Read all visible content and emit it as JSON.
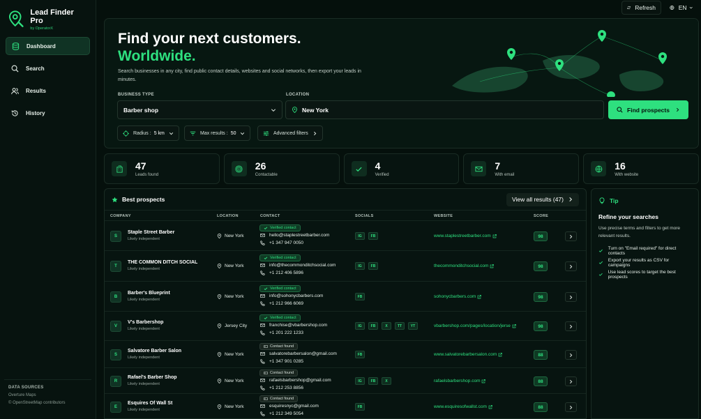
{
  "brand": {
    "title": "Lead Finder Pro",
    "subtitle": "by OperatorX"
  },
  "nav": [
    {
      "label": "Dashboard"
    },
    {
      "label": "Search"
    },
    {
      "label": "Results"
    },
    {
      "label": "History"
    }
  ],
  "sources": {
    "heading": "DATA SOURCES",
    "items": [
      "Overture Maps",
      "© OpenStreetMap contributors"
    ]
  },
  "topbar": {
    "refresh": "Refresh",
    "lang": "EN"
  },
  "hero": {
    "title_line1": "Find your next customers.",
    "title_line2": "Worldwide.",
    "description": "Search businesses in any city, find public contact details, websites and social networks, then export your leads in minutes.",
    "business_type_label": "BUSINESS TYPE",
    "business_type_value": "Barber shop",
    "location_label": "LOCATION",
    "location_value": "New York",
    "find_button": "Find prospects",
    "radius_label": "Radius :",
    "radius_value": "5 km",
    "max_label": "Max results :",
    "max_value": "50",
    "advanced": "Advanced filters"
  },
  "stats": [
    {
      "num": "47",
      "cap": "Leads found"
    },
    {
      "num": "26",
      "cap": "Contactable"
    },
    {
      "num": "4",
      "cap": "Verified"
    },
    {
      "num": "7",
      "cap": "With email"
    },
    {
      "num": "16",
      "cap": "With website"
    }
  ],
  "prospects": {
    "title": "Best prospects",
    "view_all": "View all results (47)",
    "columns": [
      "COMPANY",
      "LOCATION",
      "CONTACT",
      "SOCIALS",
      "WEBSITE",
      "SCORE"
    ],
    "rows": [
      {
        "initial": "S",
        "name": "Staple Street Barber",
        "sub": "Likely independent",
        "location": "New York",
        "badge": "Verified contact",
        "email": "hello@staplestreetbarber.com",
        "phone": "+1 347 947 0050",
        "socials": [
          "IG",
          "FB"
        ],
        "website": "www.staplestreetbarber.com",
        "score": "98"
      },
      {
        "initial": "T",
        "name": "THE COMMON DITCH SOCIAL",
        "sub": "Likely independent",
        "location": "New York",
        "badge": "Verified contact",
        "email": "info@thecommonditchsocial.com",
        "phone": "+1 212 406 5896",
        "socials": [
          "IG",
          "FB"
        ],
        "website": "thecommonditchsocial.com",
        "score": "98"
      },
      {
        "initial": "B",
        "name": "Barber's Blueprint",
        "sub": "Likely independent",
        "location": "New York",
        "badge": "Verified contact",
        "email": "info@sohonycbarbers.com",
        "phone": "+1 212 966 6069",
        "socials": [
          "FB"
        ],
        "website": "sohonycbarbers.com",
        "score": "98"
      },
      {
        "initial": "V",
        "name": "V's Barbershop",
        "sub": "Likely independent",
        "location": "Jersey City",
        "badge": "Verified contact",
        "email": "franchise@vbarbershop.com",
        "phone": "+1 201 222 1233",
        "socials": [
          "IG",
          "FB",
          "X",
          "TT",
          "YT"
        ],
        "website": "vbarbershop.com/pages/location/jerse",
        "score": "98"
      },
      {
        "initial": "S",
        "name": "Salvatore Barber Salon",
        "sub": "Likely independent",
        "location": "New York",
        "badge": "Contact found",
        "email": "salvatorebarbersalon@gmail.com",
        "phone": "+1 347 901 0285",
        "socials": [
          "FB"
        ],
        "website": "www.salvatorebarbersalon.com",
        "score": "88"
      },
      {
        "initial": "R",
        "name": "Rafael's Barber Shop",
        "sub": "Likely independent",
        "location": "New York",
        "badge": "Contact found",
        "email": "rafaelsbarbershop@gmail.com",
        "phone": "+1 212 253 8856",
        "socials": [
          "IG",
          "FB",
          "X"
        ],
        "website": "rafaelsbarbershop.com",
        "score": "88"
      },
      {
        "initial": "E",
        "name": "Esquires Of Wall St",
        "sub": "Likely independent",
        "location": "New York",
        "badge": "Contact found",
        "email": "esquiresnyc@gmail.com",
        "phone": "+1 212 349 5054",
        "socials": [
          "FB"
        ],
        "website": "www.esquiresofwallst.com",
        "score": "88"
      }
    ]
  },
  "tip": {
    "label": "Tip",
    "title": "Refine your searches",
    "desc": "Use precise terms and filters to get more relevant results.",
    "items": [
      "Turn on \"Email required\" for direct contacts",
      "Export your results as CSV for campaigns",
      "Use lead scores to target the best prospects"
    ]
  },
  "colors": {
    "accent": "#2ee07f",
    "background": "#05100c",
    "panel": "#071410"
  }
}
